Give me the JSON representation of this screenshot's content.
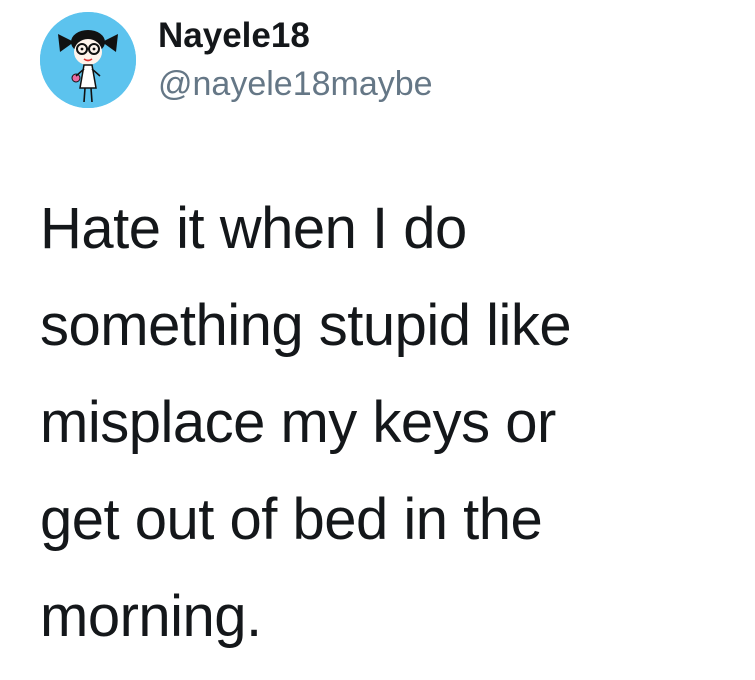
{
  "author": {
    "display_name": "Nayele18",
    "handle": "@nayele18maybe",
    "avatar_icon": "cartoon-girl-avatar-icon",
    "avatar_background": "#5cc3ee"
  },
  "tweet": {
    "lines": [
      "Hate it when I do",
      "something stupid like",
      "misplace my keys or",
      "get out of bed in the",
      "morning."
    ]
  },
  "colors": {
    "text": "#14171a",
    "secondary_text": "#657786",
    "background": "#ffffff"
  }
}
